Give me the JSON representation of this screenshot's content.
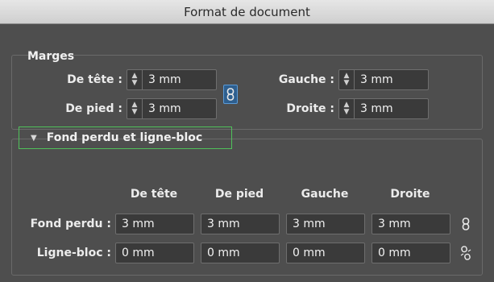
{
  "window": {
    "title": "Format de document"
  },
  "margins": {
    "title": "Marges",
    "top_label": "De tête :",
    "top_value": "3 mm",
    "bottom_label": "De pied :",
    "bottom_value": "3 mm",
    "left_label": "Gauche :",
    "left_value": "3 mm",
    "right_label": "Droite :",
    "right_value": "3 mm",
    "linked": true
  },
  "bleed_slug": {
    "section_title": "Fond perdu et ligne-bloc",
    "expanded": true,
    "columns": [
      "De tête",
      "De pied",
      "Gauche",
      "Droite"
    ],
    "rows": [
      {
        "label": "Fond perdu :",
        "values": [
          "3 mm",
          "3 mm",
          "3 mm",
          "3 mm"
        ],
        "linked": true
      },
      {
        "label": "Ligne-bloc :",
        "values": [
          "0 mm",
          "0 mm",
          "0 mm",
          "0 mm"
        ],
        "linked": false
      }
    ]
  },
  "icons": {
    "link": "chain-link-icon",
    "unlink": "broken-chain-icon",
    "stepper": "up-down-stepper-icon",
    "disclosure": "chevron-down-icon"
  },
  "colors": {
    "panel": "#4e4e4e",
    "field": "#3a3a3a",
    "focus_green": "#4fc15a",
    "link_active": "#2e5f8f"
  }
}
